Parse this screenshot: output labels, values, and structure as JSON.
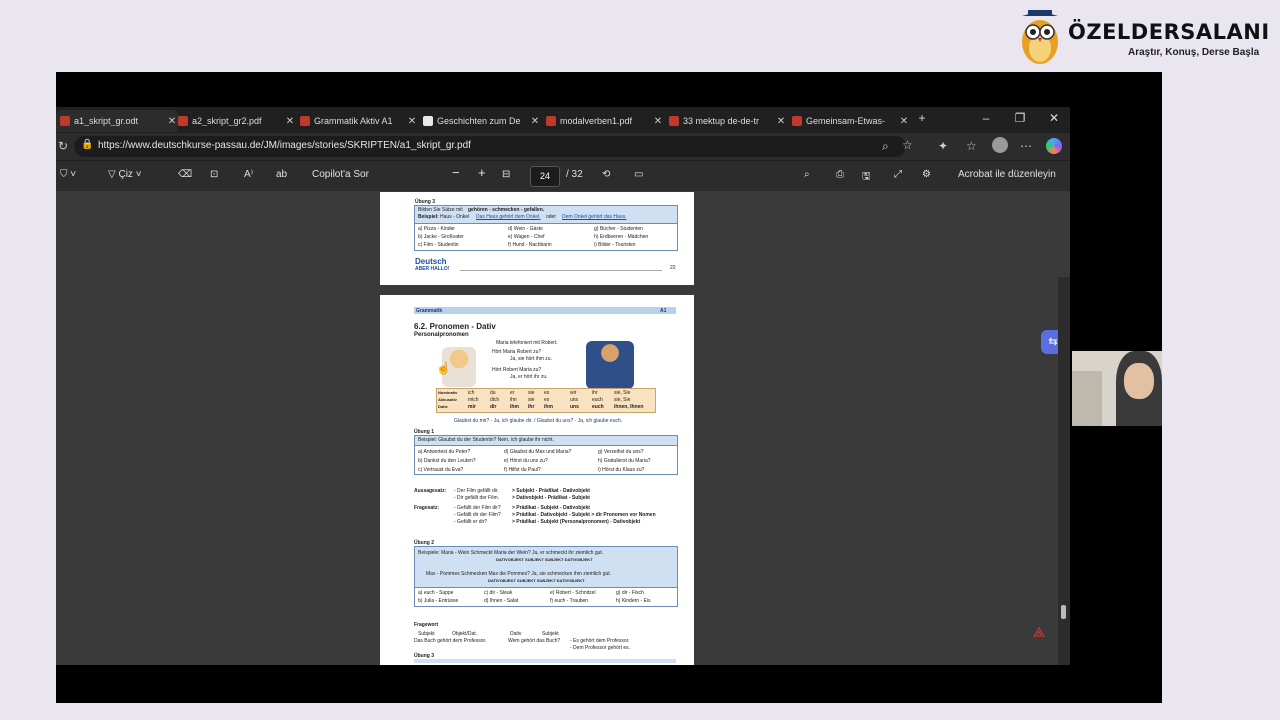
{
  "brand": {
    "title": "ÖZELDERSALANI",
    "tagline": "Araştır, Konuş, Derse Başla"
  },
  "tabs": [
    {
      "label": "a1_skript_gr.odt",
      "icon": "pdf-icon"
    },
    {
      "label": "a2_skript_gr2.pdf",
      "icon": "pdf-icon"
    },
    {
      "label": "Grammatik Aktiv A1",
      "icon": "pdf-icon"
    },
    {
      "label": "Geschichten zum De",
      "icon": "document-icon"
    },
    {
      "label": "modalverben1.pdf",
      "icon": "pdf-icon"
    },
    {
      "label": "33 mektup de-de-tr",
      "icon": "pdf-icon"
    },
    {
      "label": "Gemeinsam-Etwas-",
      "icon": "pdf-icon"
    }
  ],
  "address": {
    "url": "https://www.deutschkurse-passau.de/JM/images/stories/SKRIPTEN/a1_skript_gr.pdf"
  },
  "pdf_toolbar": {
    "draw_label": "Çiz",
    "copilot_label": "Copilot'a Sor",
    "current_page": "24",
    "total_pages": "/ 32",
    "acrobat_label": "Acrobat ile düzenleyin"
  },
  "page_prev": {
    "exercise_title": "Übung 3",
    "instruction_a": "Bilden Sie Sätze mit",
    "instruction_verbs": "gehören - schmecken - gefallen.",
    "example_label": "Beispiel:",
    "example_text": "Haus - Onkel",
    "example_answer1": "Das Haus gehört dem Onkel.",
    "example_or": "oder",
    "example_answer2": "Dem Onkel gehört das Haus.",
    "items": [
      "a) Pizza - Kinder",
      "d) Wein - Gäste",
      "g) Bücher - Studenten",
      "b) Jacke - Großvater",
      "e) Wagen - Chef",
      "h) Erdbeeren - Mädchen",
      "c) Film - Studentin",
      "f) Hund - Nachbarin",
      "i) Bilder - Touristen"
    ],
    "logo_top": "Deutsch",
    "logo_bottom": "ABER HALLO!",
    "page_number": "22"
  },
  "page_cur": {
    "header": "Grammatik",
    "level": "A1",
    "section_title": "6.2. Pronomen - Dativ",
    "subtitle": "Personalpronomen",
    "dialog": [
      "Maria telefoniert mit Robert.",
      "Hört Maria Robert zu?",
      "Ja, sie hört ihm zu.",
      "Hört Robert Maria zu?",
      "Ja, er hört ihr zu."
    ],
    "table_rows": [
      {
        "label": "Nominativ",
        "cells": [
          "ich",
          "du",
          "er",
          "sie",
          "es",
          "wir",
          "ihr",
          "sie, Sie"
        ]
      },
      {
        "label": "Akkusativ",
        "cells": [
          "mich",
          "dich",
          "ihn",
          "sie",
          "es",
          "uns",
          "euch",
          "sie, Sie"
        ]
      },
      {
        "label": "Dativ",
        "cells": [
          "mir",
          "dir",
          "ihm",
          "ihr",
          "ihm",
          "uns",
          "euch",
          "ihnen, Ihnen"
        ]
      }
    ],
    "note": "Glaubst du mir? - Ja, ich glaube dir. / Glaubst du uns? - Ja, ich glaube euch.",
    "ex1_title": "Übung 1",
    "ex1_example": "Beispiel:  Glaubst du der Studentin?  Nein, ich glaube ihr nicht.",
    "ex1_items": [
      "a) Antwortest du Peter?",
      "d) Glaubst du Max und Maria?",
      "g) Verzeihst du uns?",
      "b) Dankst du den Leuten?",
      "e) Hörst du uns zu?",
      "h) Gratulierst du Maria?",
      "c) Vertraust du Eva?",
      "f) Hilfst du Paul?",
      "i) Hörst du Klaus zu?"
    ],
    "aussage_label": "Aussagesatz:",
    "aussage_lines": [
      "- Der Film gefällt dir.",
      "- Dir gefällt der Film."
    ],
    "aussage_rules": [
      "> Subjekt - Prädikat - Dativobjekt",
      "> Dativobjekt - Prädikat - Subjekt"
    ],
    "frage_label": "Fragesatz:",
    "frage_lines": [
      "- Gefällt der Film dir?",
      "- Gefällt dir der Film?",
      "- Gefällt er dir?"
    ],
    "frage_rules": [
      "> Prädikat - Subjekt - Dativobjekt",
      "> Prädikat - Dativobjekt - Subjekt > dir Pronomen vor Nomen",
      "> Prädikat - Subjekt (Personalpronomen) - Dativobjekt"
    ],
    "ex2_title": "Übung 2",
    "ex2_example1": "Beispiele:  Maria - Wein  Schmeckt  Maria  der Wein?  Ja, er schmeckt ihr ziemlich gut.",
    "ex2_tags1": "DATIVOBJEKT  SUBJEKT        SUBJEKT  DATIVOBJEKT",
    "ex2_example2": "Max - Pommes  Schmecken  Max  die Pommes?  Ja, sie schmecken ihm ziemlich gut.",
    "ex2_tags2": "DATIVOBJEKT  SUBJEKT        SUBJEKT  DATIVOBJEKT",
    "ex2_items": [
      "a) euch - Suppe",
      "c) dir - Steak",
      "e) Robert - Schnitzel",
      "g) dir - Fisch",
      "b) Julia - Entrüsse",
      "d) Ihnen - Salat",
      "f) euch - Trauben",
      "h) Kindern - Eis"
    ],
    "fragewort_title": "Fragewort",
    "fw_head": [
      "Subjekt",
      "Objekt/Dat.",
      "Dativ",
      "Subjekt"
    ],
    "fw_line1": "Das Buch gehört dem Professor.",
    "fw_line1b": "Wem gehört das Buch?",
    "fw_line1c": "- Es gehört dem Professor.",
    "fw_line2": "- Dem Professor gehört es.",
    "ex3_title": "Übung 3"
  }
}
